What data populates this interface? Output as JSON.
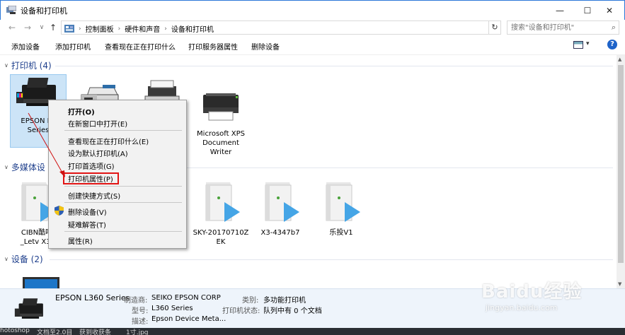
{
  "window": {
    "title": "设备和打印机",
    "icon": "devices-printers-icon",
    "controls": {
      "minimize": "—",
      "maximize": "☐",
      "close": "✕"
    }
  },
  "address": {
    "back": "←",
    "forward": "→",
    "up": "↑",
    "crumbs": [
      "控制面板",
      "硬件和声音",
      "设备和打印机"
    ],
    "dropdown": "⌄",
    "refresh": "↻",
    "search_placeholder": "搜索\"设备和打印机\"",
    "search_icon": "search-icon"
  },
  "toolbar": {
    "items": [
      "添加设备",
      "添加打印机",
      "查看现在正在打印什么",
      "打印服务器属性",
      "删除设备"
    ],
    "view_dropdown": "▾",
    "help": "?"
  },
  "groups": {
    "printers": {
      "title": "打印机 (4)",
      "chev": "∨"
    },
    "media": {
      "title": "多媒体设",
      "chev": "∨"
    },
    "devices": {
      "title": "设备 (2)",
      "chev": "∨"
    }
  },
  "printers": [
    {
      "label": "EPSON L3\nSeries",
      "icon": "inkjet-printer-icon",
      "selected": true
    },
    {
      "label": "",
      "icon": "fax-icon",
      "selected": false
    },
    {
      "label": "",
      "icon": "printer-icon",
      "selected": false
    },
    {
      "label": "Microsoft XPS\nDocument\nWriter",
      "icon": "printer-icon",
      "selected": false
    }
  ],
  "media": [
    {
      "label": "CIBN酷喵\n_Letv X3-",
      "icon": "media-server-icon"
    },
    {
      "label": "SKY-20170710Z\nEK",
      "icon": "media-server-icon"
    },
    {
      "label": "X3-4347b7",
      "icon": "media-server-icon"
    },
    {
      "label": "乐投V1",
      "icon": "media-server-icon"
    }
  ],
  "context_menu": {
    "items": [
      {
        "label": "打开(O)",
        "bold": true
      },
      {
        "label": "在新窗口中打开(E)"
      },
      {
        "label": "查看现在正在打印什么(E)"
      },
      {
        "label": "设为默认打印机(A)"
      },
      {
        "label": "打印首选项(G)"
      },
      {
        "label": "打印机属性(P)",
        "highlighted": true
      },
      {
        "label": "创建快捷方式(S)"
      },
      {
        "label": "删除设备(V)",
        "icon": "uac-shield-icon"
      },
      {
        "label": "疑难解答(T)"
      },
      {
        "label": "属性(R)"
      }
    ]
  },
  "details": {
    "name": "EPSON L360 Series",
    "fields": [
      {
        "label": "制造商:",
        "value": "SEIKO EPSON CORP"
      },
      {
        "label": "型号:",
        "value": "L360 Series"
      },
      {
        "label": "描述:",
        "value": "Epson Device Meta..."
      },
      {
        "label": "类别:",
        "value": "多功能打印机"
      },
      {
        "label": "打印机状态:",
        "value": "队列中有 0 个文档"
      }
    ]
  },
  "taskbar": [
    "hotoshop",
    "文档至2.0目",
    "获到收获条",
    "1寸.jpg"
  ],
  "watermark": {
    "main": "Baidu经验",
    "sub": "jingyan.baidu.com"
  },
  "colors": {
    "accent": "#2b78d8",
    "selection": "#cce4f7",
    "group_title": "#1e3f8c",
    "highlight_box": "#e21515",
    "arrow": "#d01010"
  }
}
